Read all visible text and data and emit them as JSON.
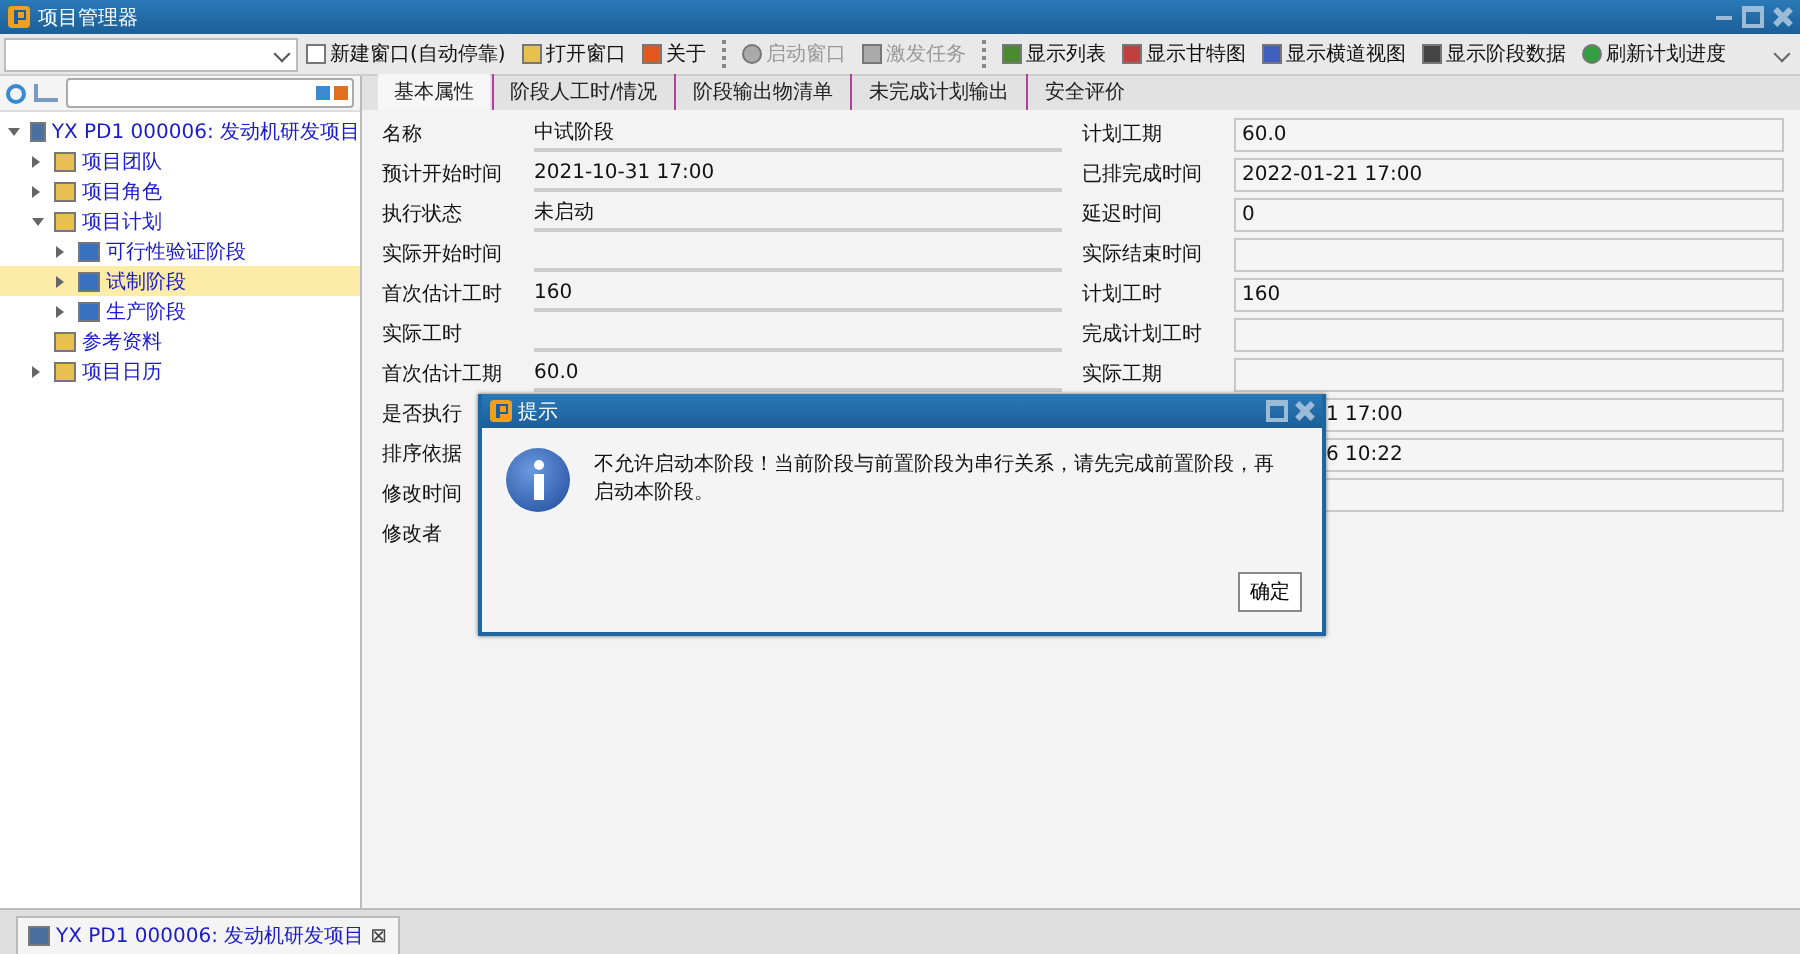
{
  "window": {
    "title": "项目管理器"
  },
  "toolbar": [
    {
      "label": "新建窗口(自动停靠)",
      "disabled": false
    },
    {
      "label": "打开窗口",
      "disabled": false
    },
    {
      "label": "关于",
      "disabled": false
    },
    {
      "label": "启动窗口",
      "disabled": true
    },
    {
      "label": "激发任务",
      "disabled": true
    },
    {
      "label": "显示列表",
      "disabled": false
    },
    {
      "label": "显示甘特图",
      "disabled": false
    },
    {
      "label": "显示横道视图",
      "disabled": false
    },
    {
      "label": "显示阶段数据",
      "disabled": false
    },
    {
      "label": "刷新计划进度",
      "disabled": false
    }
  ],
  "tree": [
    {
      "label": "YX PD1 000006: 发动机研发项目",
      "expanded": true,
      "selected": false,
      "children": [
        {
          "label": "项目团队",
          "expanded": false,
          "selected": false
        },
        {
          "label": "项目角色",
          "expanded": false,
          "selected": false
        },
        {
          "label": "项目计划",
          "expanded": true,
          "selected": false,
          "children": [
            {
              "label": "可行性验证阶段",
              "expanded": false,
              "selected": false
            },
            {
              "label": "试制阶段",
              "expanded": false,
              "selected": true
            },
            {
              "label": "生产阶段",
              "expanded": false,
              "selected": false
            }
          ]
        },
        {
          "label": "参考资料",
          "selected": false
        },
        {
          "label": "项目日历",
          "expanded": false,
          "selected": false
        }
      ]
    }
  ],
  "tabs": [
    {
      "label": "基本属性",
      "selected": true
    },
    {
      "label": "阶段人工时/情况",
      "selected": false
    },
    {
      "label": "阶段输出物清单",
      "selected": false
    },
    {
      "label": "未完成计划输出",
      "selected": false
    },
    {
      "label": "安全评价",
      "selected": false
    }
  ],
  "form_left": [
    {
      "label": "名称",
      "value": "中试阶段"
    },
    {
      "label": "预计开始时间",
      "value": "2021-10-31 17:00"
    },
    {
      "label": "执行状态",
      "value": "未启动"
    },
    {
      "label": "实际开始时间"
    },
    {
      "label": "首次估计工时",
      "value": "160"
    },
    {
      "label": "实际工时"
    },
    {
      "label": "首次估计工期",
      "value": "60.0"
    },
    {
      "label": "是否执行"
    },
    {
      "label": "排序依据"
    },
    {
      "label": "修改时间"
    },
    {
      "label": "修改者"
    }
  ],
  "form_right": [
    {
      "label": "计划工期",
      "value": "60.0"
    },
    {
      "label": "已排完成时间",
      "value": "2022-01-21 17:00"
    },
    {
      "label": "延迟时间",
      "value": "0"
    },
    {
      "label": "实际结束时间"
    },
    {
      "label": "计划工时",
      "value": "160"
    },
    {
      "label": "完成计划工时"
    },
    {
      "label": "实际工期"
    },
    {
      "value": "1 17:00"
    },
    {
      "value": "6 10:22"
    }
  ],
  "dialog": {
    "title": "提示",
    "message": "不允许启动本阶段！当前阶段与前置阶段为串行关系，请先完成前置阶段，再启动本阶段。",
    "button": "确定"
  },
  "bottom_tab": {
    "label": "YX PD1 000006: 发动机研发项目",
    "close": "⊠"
  }
}
